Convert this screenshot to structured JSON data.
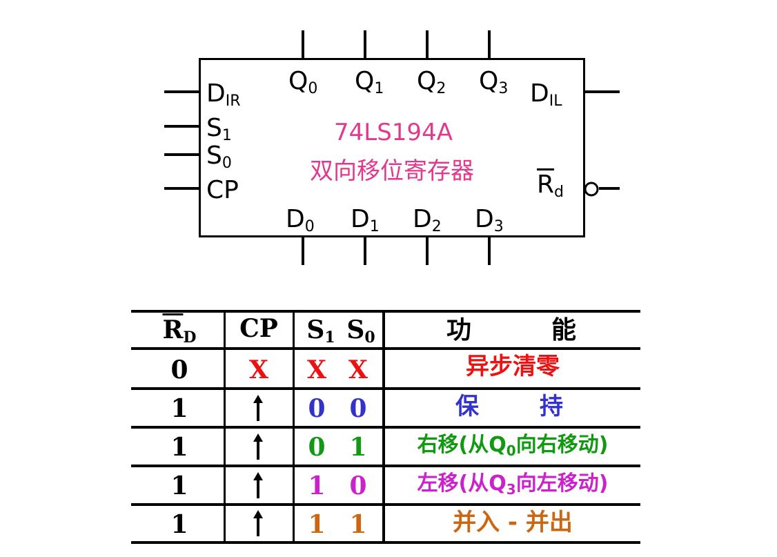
{
  "chip": {
    "title": "74LS194A",
    "subtitle": "双向移位寄存器",
    "pins": {
      "q0": {
        "main": "Q",
        "sub": "0"
      },
      "q1": {
        "main": "Q",
        "sub": "1"
      },
      "q2": {
        "main": "Q",
        "sub": "2"
      },
      "q3": {
        "main": "Q",
        "sub": "3"
      },
      "d0": {
        "main": "D",
        "sub": "0"
      },
      "d1": {
        "main": "D",
        "sub": "1"
      },
      "d2": {
        "main": "D",
        "sub": "2"
      },
      "d3": {
        "main": "D",
        "sub": "3"
      },
      "dir": {
        "main": "D",
        "sub": "IR"
      },
      "dil": {
        "main": "D",
        "sub": "IL"
      },
      "s1": {
        "main": "S",
        "sub": "1"
      },
      "s0": {
        "main": "S",
        "sub": "0"
      },
      "cp": {
        "main": "CP"
      },
      "rd": {
        "main": "R",
        "sub": "d"
      }
    }
  },
  "table": {
    "headers": {
      "rd": {
        "main": "R",
        "sub": "D"
      },
      "cp": "CP",
      "s1": {
        "main": "S",
        "sub": "1"
      },
      "s0": {
        "main": "S",
        "sub": "0"
      },
      "func_a": "功",
      "func_b": "能"
    },
    "rows": [
      {
        "rd": "0",
        "cp": "X",
        "s1": "X",
        "s0": "X",
        "func": "异步清零",
        "color": "#ee1111"
      },
      {
        "rd": "1",
        "cp": "↑",
        "s1": "0",
        "s0": "0",
        "func_a": "保",
        "func_b": "持",
        "color": "#3333cc"
      },
      {
        "rd": "1",
        "cp": "↑",
        "s1": "0",
        "s0": "1",
        "func_pre": "右移(从Q",
        "func_sub": "0",
        "func_post": "向右移动)",
        "color": "#119911"
      },
      {
        "rd": "1",
        "cp": "↑",
        "s1": "1",
        "s0": "0",
        "func_pre": "左移(从Q",
        "func_sub": "3",
        "func_post": "向左移动)",
        "color": "#cc22cc"
      },
      {
        "rd": "1",
        "cp": "↑",
        "s1": "1",
        "s0": "1",
        "func": "并入 - 并出",
        "color": "#cc6611"
      }
    ]
  }
}
